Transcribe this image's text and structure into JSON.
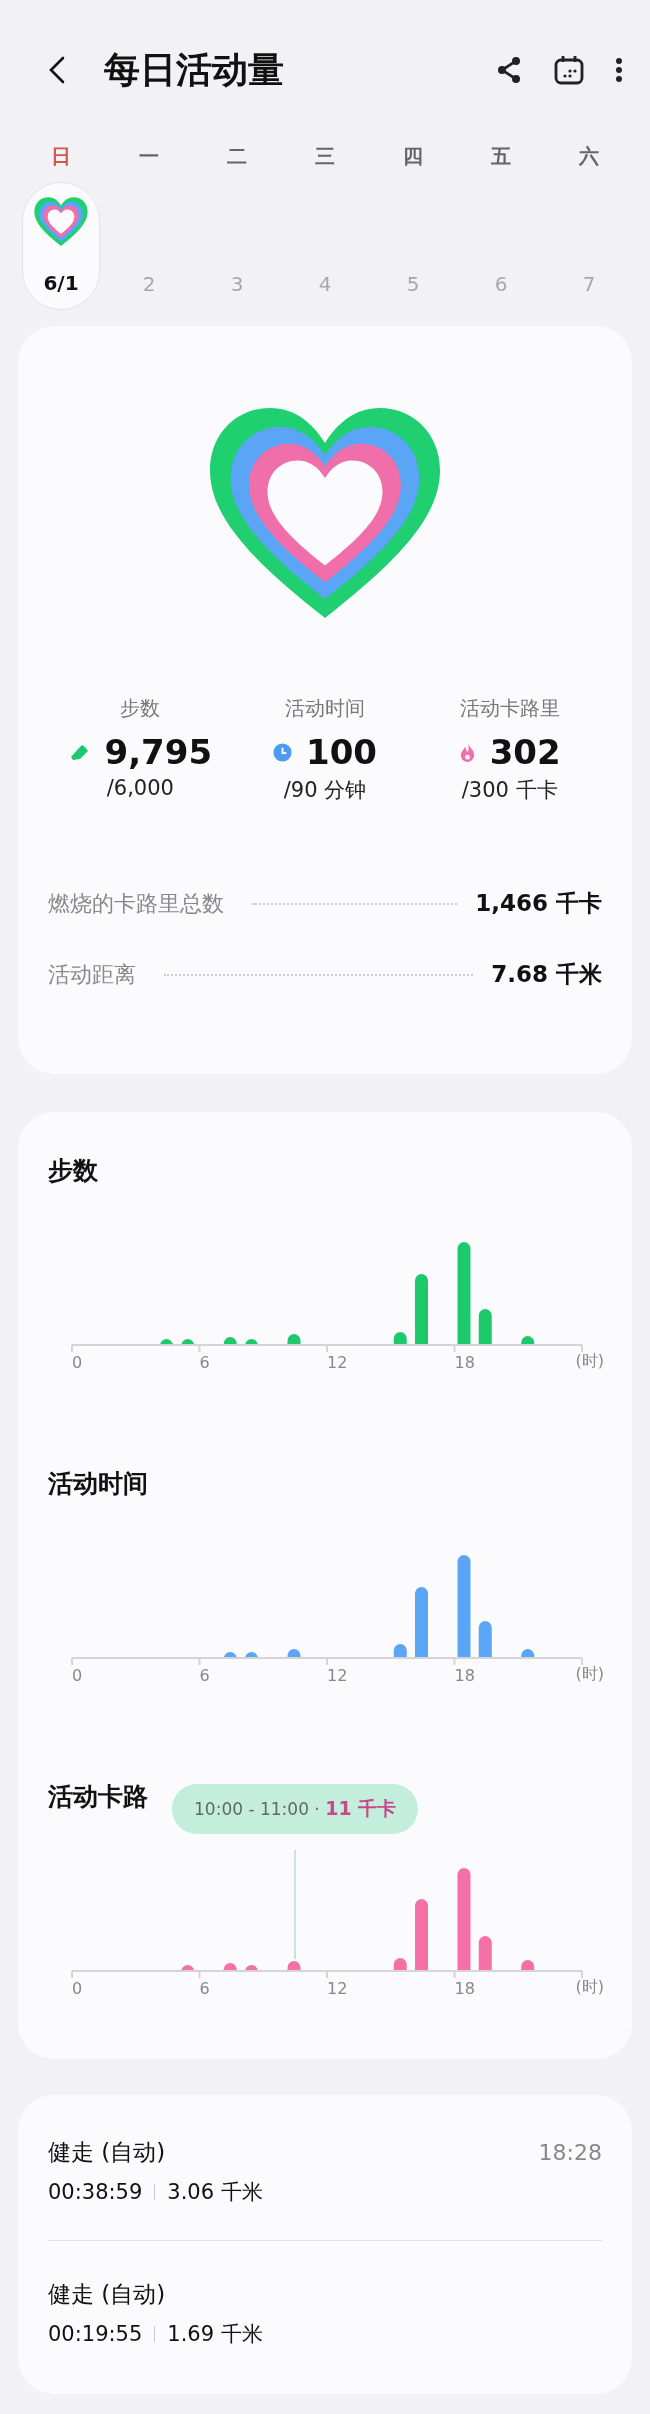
{
  "header": {
    "title": "每日活动量"
  },
  "week": [
    {
      "day": "日",
      "date": "6/1",
      "selected": true,
      "color": "#d0584f"
    },
    {
      "day": "一",
      "date": "2",
      "selected": false,
      "color": "#666666"
    },
    {
      "day": "二",
      "date": "3",
      "selected": false,
      "color": "#666666"
    },
    {
      "day": "三",
      "date": "4",
      "selected": false,
      "color": "#666666"
    },
    {
      "day": "四",
      "date": "5",
      "selected": false,
      "color": "#666666"
    },
    {
      "day": "五",
      "date": "6",
      "selected": false,
      "color": "#666666"
    },
    {
      "day": "六",
      "date": "7",
      "selected": false,
      "color": "#666666"
    }
  ],
  "stats": [
    {
      "kind": "steps",
      "label": "步数",
      "value": "9,795",
      "goal": "/6,000"
    },
    {
      "kind": "time",
      "label": "活动时间",
      "value": "100",
      "goal": "/90 分钟"
    },
    {
      "kind": "calories",
      "label": "活动卡路里",
      "value": "302",
      "goal": "/300 千卡"
    }
  ],
  "totals": [
    {
      "label": "燃烧的卡路里总数",
      "value": "1,466 千卡"
    },
    {
      "label": "活动距离",
      "value": "7.68 千米"
    }
  ],
  "charts": [
    {
      "kind": "steps",
      "title": "步数",
      "color": "#1ec96e",
      "ticks": [
        "0",
        "6",
        "12",
        "18"
      ],
      "unit": "(时)"
    },
    {
      "kind": "time",
      "title": "活动时间",
      "color": "#5aa5f5",
      "ticks": [
        "0",
        "6",
        "12",
        "18"
      ],
      "unit": "(时)"
    },
    {
      "kind": "calories",
      "title": "活动卡路",
      "color": "#f56fa8",
      "ticks": [
        "0",
        "6",
        "12",
        "18"
      ],
      "unit": "(时)",
      "tooltip": "10:00 - 11:00 · **11 千卡**"
    }
  ],
  "sessions": [
    {
      "title": "健走 (自动)",
      "time": "18:28",
      "duration": "00:38:59",
      "distance": "3.06 千米"
    },
    {
      "title": "健走 (自动)",
      "duration": "00:19:55",
      "distance": "1.69 千米"
    }
  ]
}
